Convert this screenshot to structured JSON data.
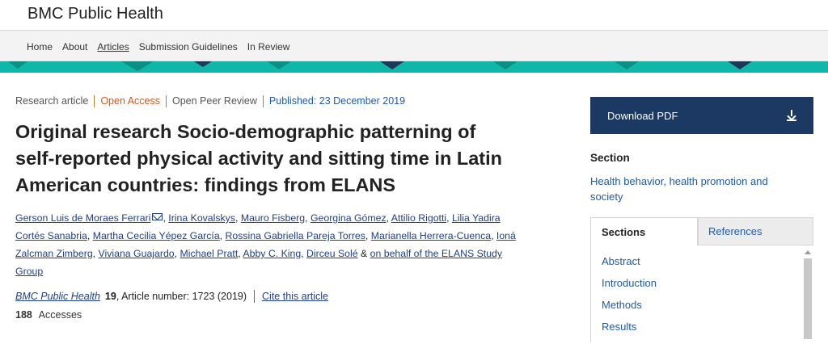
{
  "header": {
    "journal": "BMC Public Health"
  },
  "nav": {
    "items": [
      "Home",
      "About",
      "Articles",
      "Submission Guidelines",
      "In Review"
    ],
    "active": "Articles"
  },
  "meta": {
    "type": "Research article",
    "access": "Open Access",
    "review": "Open Peer Review",
    "published": "Published: 23 December 2019"
  },
  "title": "Original research Socio-demographic patterning of self-reported physical activity and sitting time in Latin American countries: findings from ELANS",
  "authors": [
    "Gerson Luis de Moraes Ferrari",
    "Irina Kovalskys",
    "Mauro Fisberg",
    "Georgina Gómez",
    "Attilio Rigotti",
    "Lilia Yadira Cortés Sanabria",
    "Martha Cecilia Yépez García",
    "Rossina Gabriella Pareja Torres",
    "Marianella Herrera-Cuenca",
    "Ioná Zalcman Zimberg",
    "Viviana Guajardo",
    "Michael Pratt",
    "Abby C. King",
    "Dirceu Solé"
  ],
  "authors_amp": "&",
  "authors_group": "on behalf of the ELANS Study Group",
  "citation": {
    "journal": "BMC Public Health",
    "volume": "19",
    "rest": ", Article number: 1723 (2019)",
    "cite_link": "Cite this article"
  },
  "accesses": {
    "count": "188",
    "label": "Accesses"
  },
  "sidebar": {
    "download": "Download PDF",
    "section_heading": "Section",
    "section_link": "Health behavior, health promotion and society",
    "tab_sections": "Sections",
    "tab_references": "References",
    "sections": [
      "Abstract",
      "Introduction",
      "Methods",
      "Results"
    ]
  },
  "colors": {
    "accent_band": "#10b6a7",
    "download_bg": "#1b3962",
    "link": "#1f5aa6",
    "open_access": "#d05a1c"
  }
}
